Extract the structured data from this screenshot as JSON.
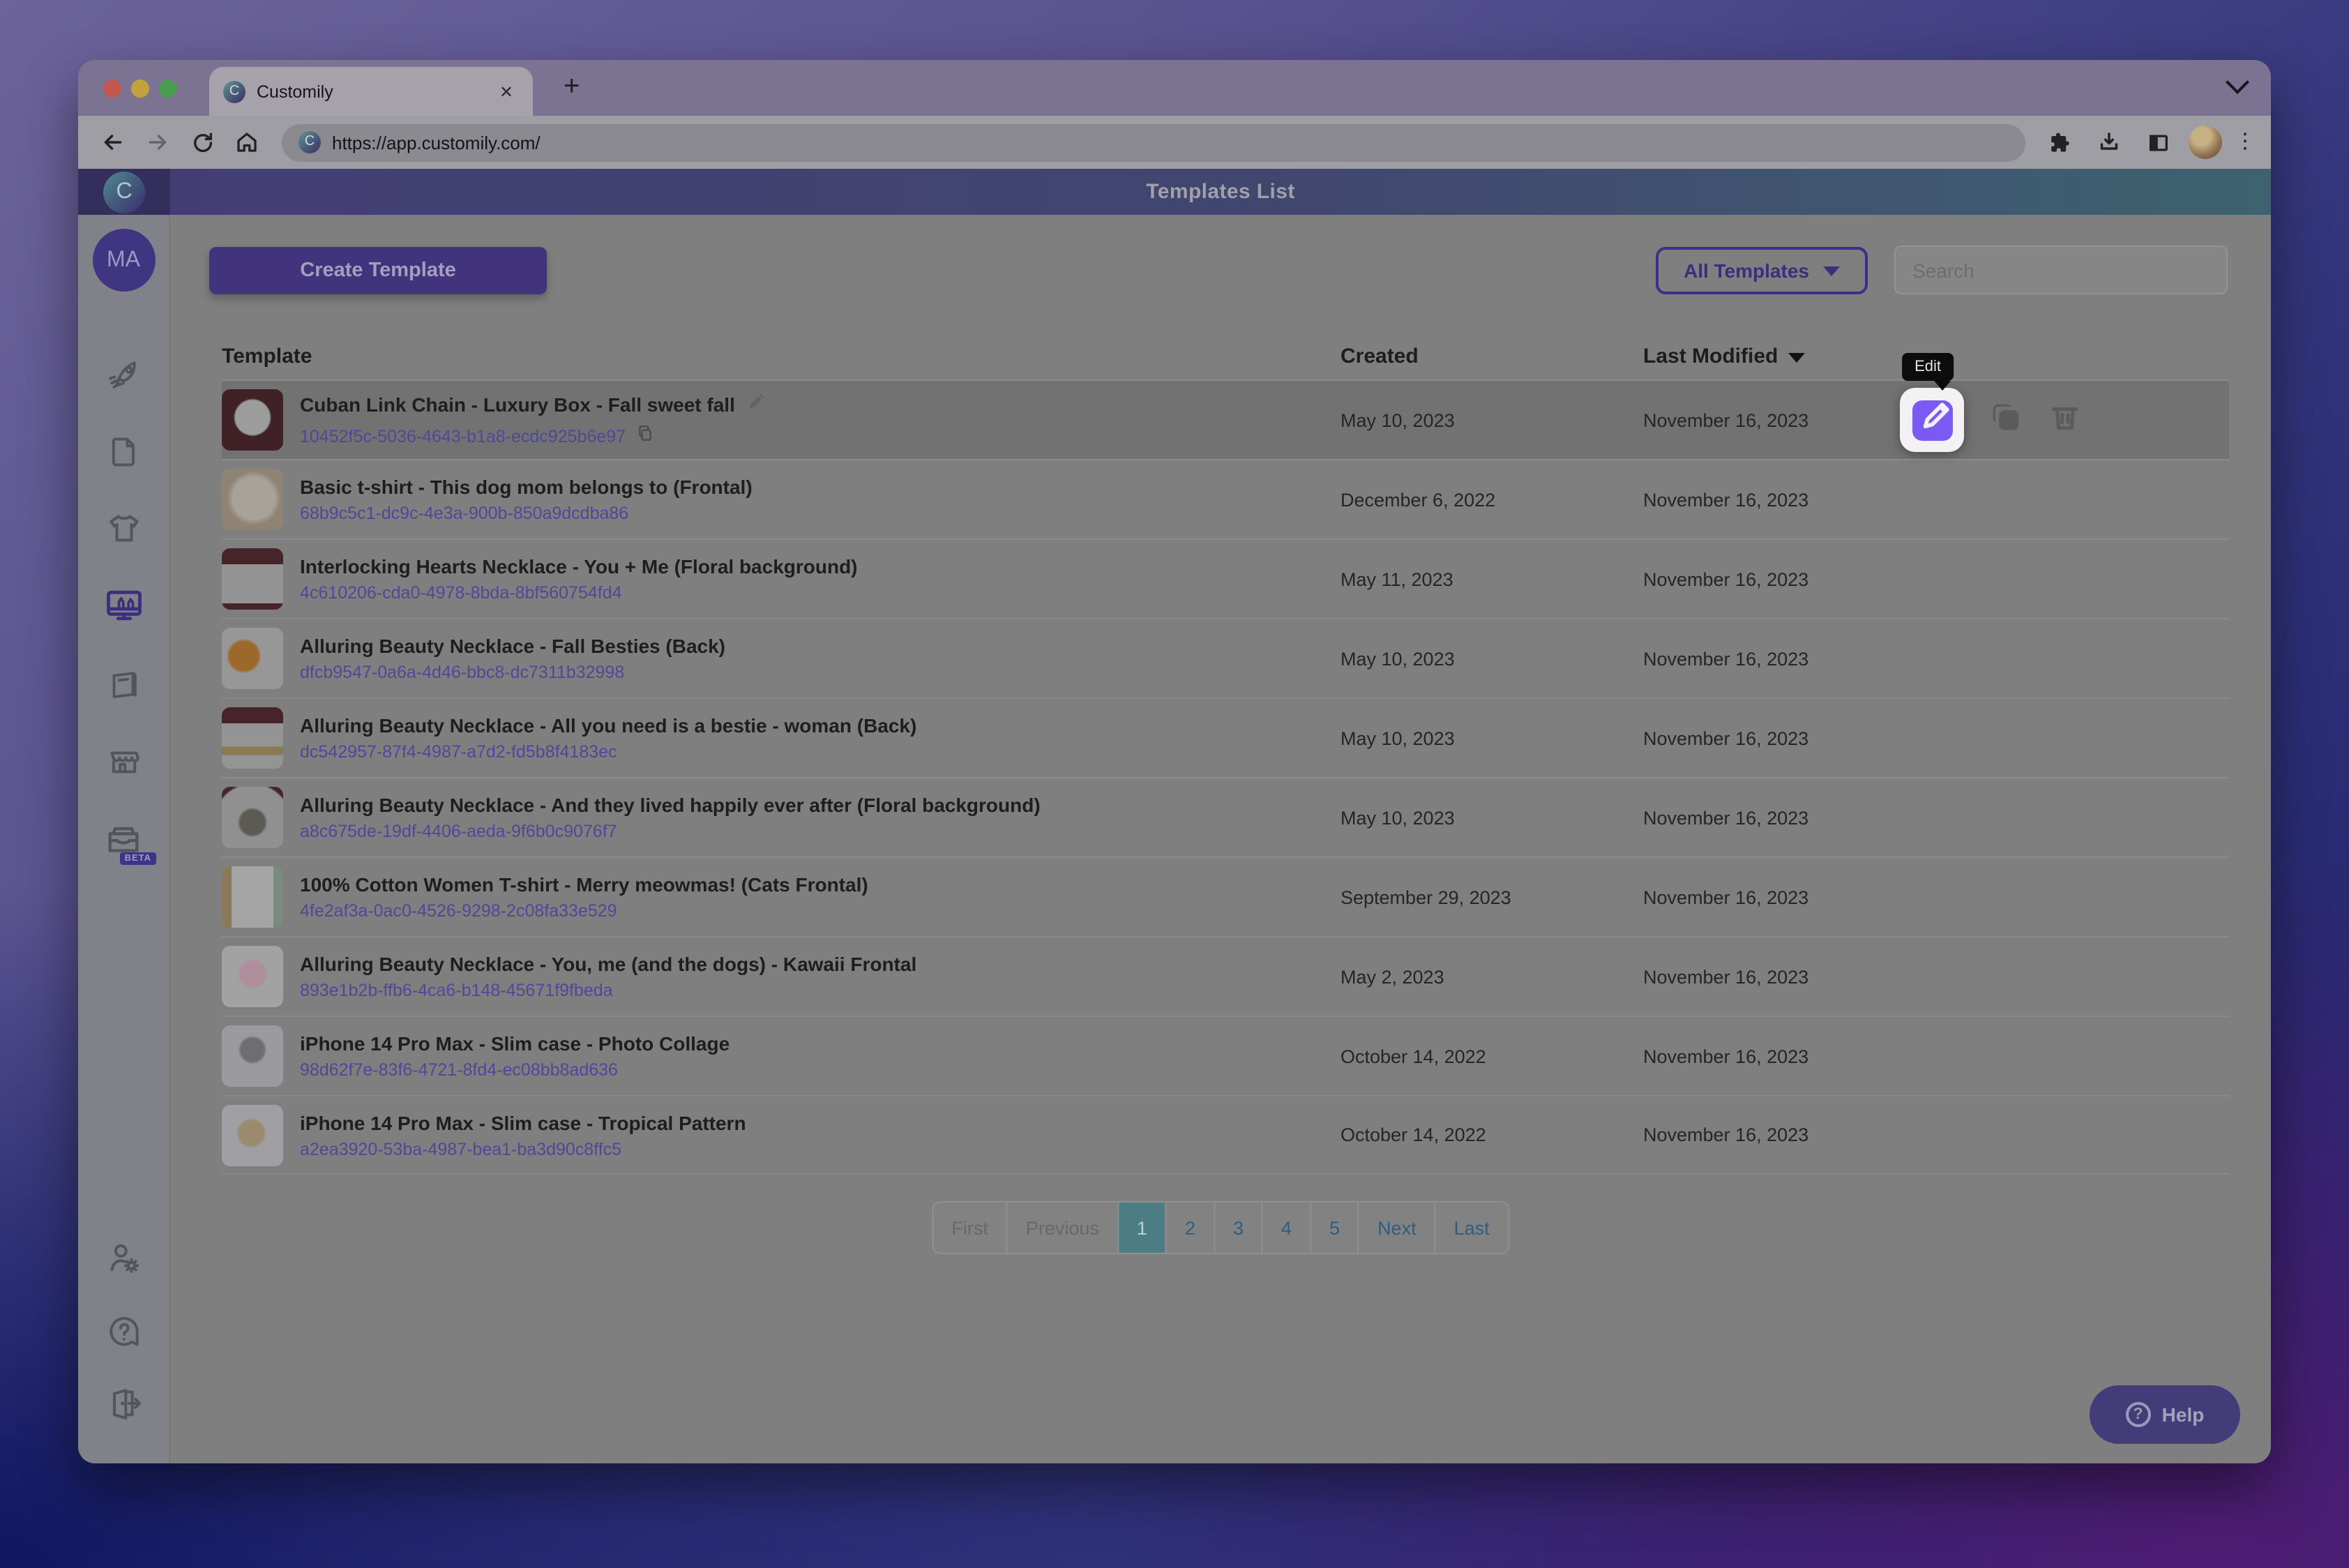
{
  "browser": {
    "tab_title": "Customily",
    "close_tab_glyph": "✕",
    "new_tab_glyph": "+",
    "url": "https://app.customily.com/"
  },
  "app_header": {
    "title": "Templates List",
    "logo_letter": "C",
    "avatar_initials": "MA"
  },
  "controls": {
    "create_button": "Create Template",
    "filter_dropdown_value": "All Templates",
    "search_placeholder": "Search"
  },
  "sidebar": {
    "icons": [
      "rocket-icon",
      "file-icon",
      "tshirt-icon",
      "design-monitor-icon",
      "pages-icon",
      "store-icon",
      "inbox-icon",
      "user-settings-icon",
      "support-icon",
      "logout-icon"
    ],
    "active_icon": "design-monitor-icon",
    "beta_badge": "BETA"
  },
  "table": {
    "columns": [
      "Template",
      "Created",
      "Last Modified"
    ],
    "sorted_column": "Last Modified",
    "hovered_row_index": 0,
    "rows": [
      {
        "name": "Cuban Link Chain - Luxury Box - Fall sweet fall",
        "id": "10452f5c-5036-4643-b1a8-ecdc925b6e97",
        "created": "May 10, 2023",
        "modified": "November 16, 2023",
        "thumb": "radial-gradient(circle at 50% 46%, #9c9c9c 0 38%, #402126 42%)"
      },
      {
        "name": "Basic t-shirt - This dog mom belongs to (Frontal)",
        "id": "68b9c5c1-dc9c-4e3a-900b-850a9dcdba86",
        "created": "December 6, 2022",
        "modified": "November 16, 2023",
        "thumb": "radial-gradient(circle at 52% 48%, #a7a39b 0 46%, #8f8374 60%)"
      },
      {
        "name": "Interlocking Hearts Necklace - You + Me (Floral background)",
        "id": "4c610206-cda0-4978-8bda-8bf560754fd4",
        "created": "May 11, 2023",
        "modified": "November 16, 2023",
        "thumb": "linear-gradient(180deg, #47232a 0 26%, #939393 26% 90%, #47232a 90%)"
      },
      {
        "name": "Alluring Beauty Necklace - Fall Besties (Back)",
        "id": "dfcb9547-0a6a-4d46-bbc8-dc7311b32998",
        "created": "May 10, 2023",
        "modified": "November 16, 2023",
        "thumb": "radial-gradient(circle at 36% 46%, #9c682c 0 28%, #979797 34%)"
      },
      {
        "name": "Alluring Beauty Necklace - All you need is a bestie - woman (Back)",
        "id": "dc542957-87f4-4987-a7d2-fd5b8f4183ec",
        "created": "May 10, 2023",
        "modified": "November 16, 2023",
        "thumb": "linear-gradient(180deg, #47232a 0 26%, #949494 26% 64%, #8a7a52 64% 78%, #949494 78%)"
      },
      {
        "name": "Alluring Beauty Necklace - And they lived happily ever after (Floral background)",
        "id": "a8c675de-19df-4406-aeda-9f6b0c9076f7",
        "created": "May 10, 2023",
        "modified": "November 16, 2023",
        "thumb": "radial-gradient(circle at 50% 58%, #5c5a54 0 26%, #909090 32% 80%, #47232a 84%)"
      },
      {
        "name": "100% Cotton Women T-shirt - Merry meowmas! (Cats Frontal)",
        "id": "4fe2af3a-0ac0-4526-9298-2c08fa33e529",
        "created": "September 29, 2023",
        "modified": "November 16, 2023",
        "thumb": "linear-gradient(90deg, #8a7a5a 0 16%, #a5a5a5 16% 84%, #7b8a80 84%)"
      },
      {
        "name": "Alluring Beauty Necklace - You, me (and the dogs) - Kawaii Frontal",
        "id": "893e1b2b-ffb6-4ca6-b148-45671f9fbeda",
        "created": "May 2, 2023",
        "modified": "November 16, 2023",
        "thumb": "radial-gradient(circle at 50% 46%, #b08f9c 0 28%, #a2a2a2 34%)"
      },
      {
        "name": "iPhone 14 Pro Max - Slim case - Photo Collage",
        "id": "98d62f7e-83f6-4721-8fd4-ec08bb8ad636",
        "created": "October 14, 2022",
        "modified": "November 16, 2023",
        "thumb": "radial-gradient(circle at 50% 40%, #6d6d72 0 24%, #9b9b9f 30%)"
      },
      {
        "name": "iPhone 14 Pro Max - Slim case - Tropical Pattern",
        "id": "a2ea3920-53ba-4987-bea1-ba3d90c8ffc5",
        "created": "October 14, 2022",
        "modified": "November 16, 2023",
        "thumb": "radial-gradient(circle at 48% 46%, #9a8a6e 0 26%, #a0a0a4 34%)"
      }
    ]
  },
  "row_actions": {
    "edit_tooltip": "Edit",
    "icons": [
      "edit-icon",
      "duplicate-icon",
      "trash-icon"
    ]
  },
  "pagination": {
    "items": [
      {
        "label": "First",
        "state": "disabled"
      },
      {
        "label": "Previous",
        "state": "disabled"
      },
      {
        "label": "1",
        "state": "active"
      },
      {
        "label": "2",
        "state": "link"
      },
      {
        "label": "3",
        "state": "link"
      },
      {
        "label": "4",
        "state": "link"
      },
      {
        "label": "5",
        "state": "link"
      },
      {
        "label": "Next",
        "state": "link"
      },
      {
        "label": "Last",
        "state": "link"
      }
    ]
  },
  "help": {
    "label": "Help"
  },
  "colors": {
    "accent_purple": "#41337c",
    "edit_highlight_purple": "#7a5af2",
    "active_page_teal": "#4c7c84",
    "link_blue": "#2e5d80",
    "id_link_purple": "#4f4798",
    "header_gradient": [
      "#433d74",
      "#3e6270"
    ],
    "tooltip_bg": "#0c0c0c"
  }
}
